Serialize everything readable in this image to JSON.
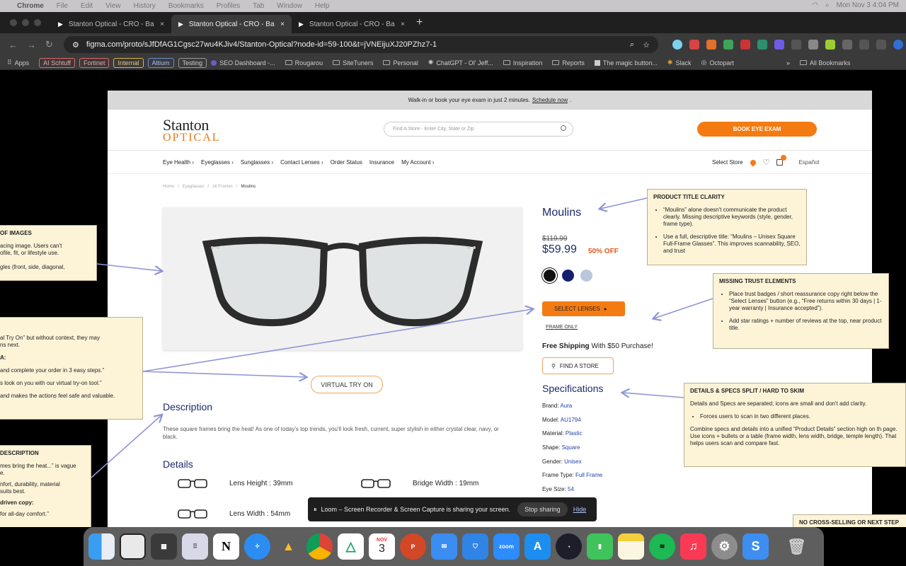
{
  "menubar": {
    "app": "Chrome",
    "items": [
      "File",
      "Edit",
      "View",
      "History",
      "Bookmarks",
      "Profiles",
      "Tab",
      "Window",
      "Help"
    ],
    "clock": "Mon Nov 3  4:04 PM"
  },
  "tabs": [
    {
      "label": "Stanton Optical - CRO - Barri"
    },
    {
      "label": "Stanton Optical - CRO - Barri"
    },
    {
      "label": "Stanton Optical - CRO - Barri"
    }
  ],
  "address": {
    "url": "figma.com/proto/sJfDfAG1Cgsc27wu4KJiv4/Stanton-Optical?node-id=59-100&t=jVNEijuXJ20PZhz7-1"
  },
  "bookmarks": {
    "apps": "Apps",
    "chips": [
      {
        "label": "AI Schtuff",
        "color": "#e06666"
      },
      {
        "label": "Fortinet",
        "color": "#e06666"
      },
      {
        "label": "Internal",
        "color": "#e0b04a"
      },
      {
        "label": "Altium",
        "color": "#6f8cd6"
      },
      {
        "label": "Testing",
        "color": "#999999"
      }
    ],
    "items": [
      "SEO Dashboard -...",
      "Rougarou",
      "SiteTuners",
      "Personal",
      "ChatGPT - Ol' Jeff...",
      "Inspiration",
      "Reports",
      "The magic button...",
      "Slack",
      "Octopart"
    ],
    "all": "All Bookmarks"
  },
  "site": {
    "announce": "Walk-in or book your eye exam in just 2 minutes.",
    "announce_link": "Schedule now",
    "logo_top": "Stanton",
    "logo_bottom": "OPTICAL",
    "search_placeholder": "Find A Store - Enter City, State or Zip",
    "book_button": "BOOK EYE EXAM",
    "nav": [
      "Eye Health ›",
      "Eyeglasses ›",
      "Sunglasses ›",
      "Contact Lenses ›",
      "Order Status",
      "Insurance",
      "My Account ›"
    ],
    "select_store": "Select Store",
    "lang": "Español",
    "crumbs": [
      "Home",
      "/",
      "Eyeglasses",
      "/",
      "All Frames",
      "/",
      "Moulins"
    ],
    "product_title": "Moulins",
    "old_price": "$119.99",
    "new_price": "$59.99",
    "discount": "50% OFF",
    "swatch_colors": [
      "#111111",
      "#14206e",
      "#b9c6de"
    ],
    "select_lenses": "SELECT LENSES",
    "frame_only": "FRAME ONLY",
    "shipping_bold": "Free Shipping",
    "shipping_rest": "With $50 Purchase!",
    "find_store": "FIND A STORE",
    "virtual_try_on": "VIRTUAL TRY ON",
    "description_title": "Description",
    "description": "These square frames bring the heat! As one of today's top trends, you'll look fresh, current, super stylish in either crystal clear, navy, or black.",
    "details_title": "Details",
    "details": [
      {
        "label": "Lens Height : 39mm"
      },
      {
        "label": "Bridge Width : 19mm"
      },
      {
        "label": "Lens Width : 54mm"
      }
    ],
    "specs_title": "Specifications",
    "specs": [
      {
        "k": "Brand:",
        "v": "Aura"
      },
      {
        "k": "Model:",
        "v": "AU1794"
      },
      {
        "k": "Material:",
        "v": "Plastic"
      },
      {
        "k": "Shape:",
        "v": "Square"
      },
      {
        "k": "Gender:",
        "v": "Unisex"
      },
      {
        "k": "Frame Type:",
        "v": "Full Frame"
      },
      {
        "k": "Eye Size:",
        "v": "54"
      }
    ]
  },
  "notes": {
    "product_title": {
      "title": "PRODUCT TITLE CLARITY",
      "b1": "“Moulins” alone doesn't communicate the product clearly. Missing descriptive keywords (style, gender, frame type).",
      "b2": "Use a full, descriptive title: “Moulins – Unisex Square Full-Frame Glasses”. This improves scannability, SEO, and trust"
    },
    "trust": {
      "title": "MISSING TRUST ELEMENTS",
      "b1": "Place trust badges / short reassurance copy right below the “Select Lenses” button (e.g., “Free returns within 30 days | 1-year warranty | Insurance accepted”).",
      "b2": "Add star ratings + number of reviews at the top, near product title."
    },
    "specs": {
      "title": "DETAILS & SPECS SPLIT / HARD TO SKIM",
      "p1": "Details and Specs are separated; icons are small and don't add clarity.",
      "b1": "Forces users to scan in two different places.",
      "p2": "Combine specs and details into a unified “Product Details” section high on th page. Use icons + bullets or a table (frame width, lens width, bridge, temple length). That helps users scan and compare fast."
    },
    "images": {
      "title": "OF IMAGES",
      "l1": "acing image. Users can't",
      "l2": "ofile, fit, or lifestyle use.",
      "l3": "gles (front, side, diagonal,"
    },
    "vto": {
      "l1": "al Try On” but without context, they may",
      "l2": "ns next.",
      "l3": "A:",
      "l4": "and complete your order in 3 easy steps.”",
      "l5": "s look on you with our virtual try-on tool.”",
      "l6": "and makes the actions feel safe and valuable."
    },
    "desc": {
      "title": "DESCRIPTION",
      "l1": "mes bring the heat...” is vague",
      "l2": "e.",
      "l3": "nfort, durability, material",
      "l4": "suits best.",
      "l5": "driven copy:",
      "l6": "for all-day comfort.”"
    },
    "cross": {
      "title": "NO CROSS-SELLING OR NEXT STEP"
    }
  },
  "loom": {
    "text": "Loom – Screen Recorder & Screen Capture is sharing your screen.",
    "stop": "Stop sharing",
    "hide": "Hide"
  },
  "dock": {
    "calendar_month": "NOV",
    "calendar_day": "3",
    "zoom": "zoom"
  }
}
